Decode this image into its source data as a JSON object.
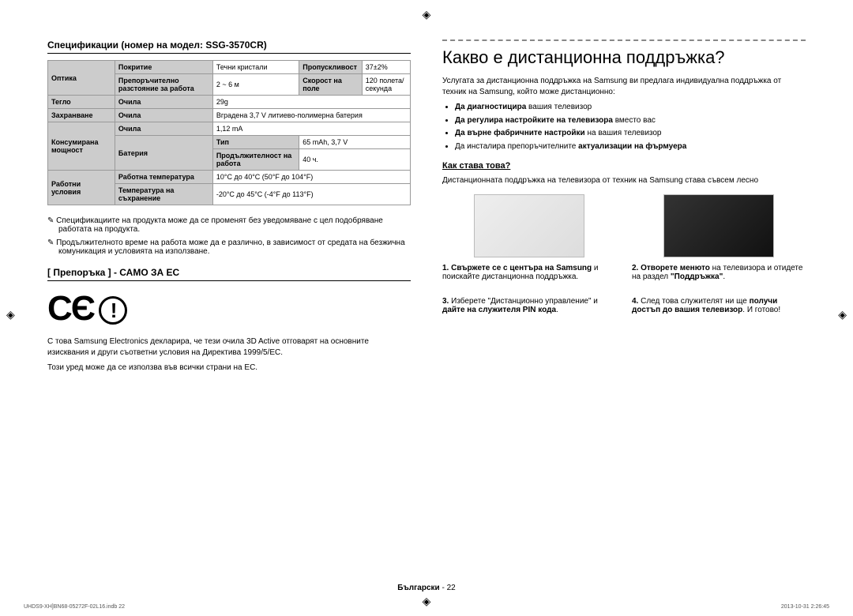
{
  "reg": "◈",
  "left": {
    "spec_title": "Спецификации (номер на модел: SSG-3570CR)",
    "table": {
      "r1": {
        "a": "Оптика",
        "b": "Покритие",
        "c": "Течни кристали",
        "d": "Пропускливост",
        "e": "37±2%"
      },
      "r2": {
        "b": "Препоръчително разстояние за работа",
        "c": "2 ~ 6 м",
        "d": "Скорост на поле",
        "e": "120 полета/секунда"
      },
      "r3": {
        "a": "Тегло",
        "b": "Очила",
        "c": "29g"
      },
      "r4": {
        "a": "Захранване",
        "b": "Очила",
        "c": "Вградена 3,7 V литиево-полимерна батерия"
      },
      "r5": {
        "a": "Консумирана мощност",
        "b": "Очила",
        "c": "1,12 mA"
      },
      "r6": {
        "b": "Батерия",
        "c": "Тип",
        "d": "65 mAh, 3,7 V"
      },
      "r7": {
        "c": "Продължителност на работа",
        "d": "40 ч."
      },
      "r8": {
        "a": "Работни условия",
        "b": "Работна температура",
        "c": "10°C до 40°C (50°F до 104°F)"
      },
      "r9": {
        "b": "Температура на съхранение",
        "c": "-20°C до 45°C (-4°F до 113°F)"
      }
    },
    "note1": "✎ Спецификациите на продукта може да се променят без уведомяване с цел подобряване работата на продукта.",
    "note2": "✎ Продължителното време на работа може да е различно, в зависимост от средата на безжична комуникация и условията на използване.",
    "rec_title": "[ Препоръка ] - САМО ЗА ЕС",
    "ce": "CЄ",
    "ce_text": "С това Samsung Electronics декларира, че тези очила 3D Active отговарят на основните изисквания и други съответни условия на Директива 1999/5/EC.",
    "eu_text": "Този уред може да се използва във всички страни на ЕС."
  },
  "right": {
    "title": "Какво е дистанционна поддръжка?",
    "intro": "Услугата за дистанционна поддръжка на Samsung ви предлага индивидуална поддръжка от техник на Samsung, който може дистанционно:",
    "bullets": [
      {
        "pre": "Да диагностицира",
        "post": " вашия телевизор"
      },
      {
        "pre": "Да регулира настройките на телевизора",
        "post": " вместо вас"
      },
      {
        "pre": "Да върне фабричните настройки",
        "post": " на вашия телевизор"
      },
      {
        "pre": "Да инсталира препоръчителните ",
        "bold": "актуализации на фърмуера",
        "post": ""
      }
    ],
    "how": "Как става това?",
    "how_text": "Дистанционната поддръжка на телевизора от техник на Samsung става съвсем лесно",
    "steps": {
      "s1": {
        "n": "1.",
        "b": "Свържете се с центъра на Samsung",
        "t": " и поискайте дистанционна поддръжка."
      },
      "s2": {
        "n": "2.",
        "b": "Отворете менюто",
        "t": " на телевизора и отидете на раздел ",
        "b2": "\"Поддръжка\"",
        "t2": "."
      },
      "s3": {
        "n": "3.",
        "t": "Изберете \"Дистанционно управление\" и ",
        "b": "дайте на служителя PIN кода",
        "t2": "."
      },
      "s4": {
        "n": "4.",
        "t": "След това служителят ни ще ",
        "b": "получи достъп до вашия телевизор",
        "t2": ". И готово!"
      }
    }
  },
  "footer": {
    "lang": "Български",
    "sep": " - ",
    "page": "22"
  },
  "tiny_left": "UHDS9-XH]BN68-05272F-02L16.indb   22",
  "tiny_right": "2013-10-31   2:26:45"
}
